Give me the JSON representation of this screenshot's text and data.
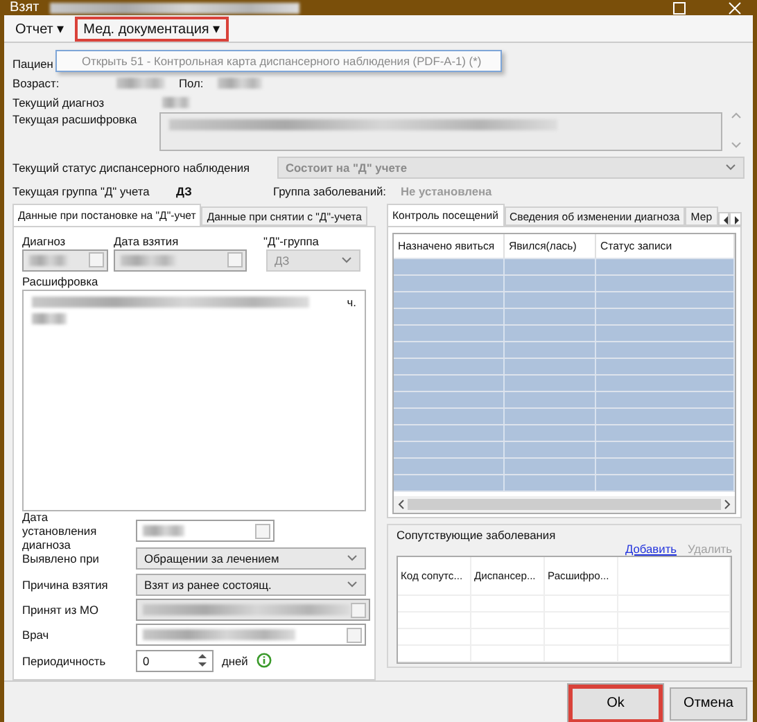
{
  "window": {
    "title": "Взят"
  },
  "menu": [
    {
      "label": "Отчет",
      "caret": "▾",
      "highlighted": false
    },
    {
      "label": "Мед. документация",
      "caret": "▾",
      "highlighted": true
    }
  ],
  "dropdown": {
    "items": [
      {
        "label": "Открыть 51 - Контрольная карта диспансерного наблюдения (PDF-A-1) (*)",
        "disabled": true
      }
    ]
  },
  "header": {
    "patient_label": "Пациен",
    "age_label": "Возраст:",
    "sex_label": "Пол:",
    "diagnosis_label": "Текущий диагноз",
    "decoding_label": "Текущая расшифровка",
    "status_label": "Текущий статус диспансерного наблюдения",
    "status_value": "Состоит на \"Д\" учете",
    "group_label": "Текущая группа \"Д\" учета",
    "group_value": "ДЗ",
    "disease_group_label": "Группа заболеваний:",
    "disease_group_value": "Не установлена"
  },
  "left_tabs": [
    {
      "label": "Данные при постановке на \"Д\"-учет",
      "selected": true
    },
    {
      "label": "Данные при снятии с \"Д\"-учета",
      "selected": false
    }
  ],
  "left_form": {
    "diagnosis_label": "Диагноз",
    "date_label": "Дата взятия",
    "group_label": "\"Д\"-группа",
    "group_value": "ДЗ",
    "decoding_label": "Расшифровка",
    "decoding_tail": "ч.",
    "diag_date_label": "Дата установления диагноза",
    "detected_label": "Выявлено при",
    "detected_value": "Обращении за лечением",
    "reason_label": "Причина взятия",
    "reason_value": "Взят из ранее состоящ.",
    "from_label": "Принят из МО",
    "doctor_label": "Врач",
    "period_label": "Периодичность",
    "period_value": "0",
    "period_unit": "дней"
  },
  "right_tabs": [
    {
      "label": "Контроль посещений",
      "selected": true
    },
    {
      "label": "Сведения об изменении диагноза",
      "selected": false
    },
    {
      "label": "Мер",
      "selected": false
    }
  ],
  "visits_table": {
    "columns": [
      "Назначено явиться",
      "Явился(лась)",
      "Статус записи"
    ]
  },
  "comorbid": {
    "title": "Сопутствующие заболевания",
    "add": "Добавить",
    "remove": "Удалить",
    "remove_disabled": true,
    "columns": [
      "Код сопутс...",
      "Диспансер...",
      "Расшифро..."
    ]
  },
  "buttons": [
    {
      "label": "Ok",
      "highlighted": true
    },
    {
      "label": "Отмена",
      "highlighted": false
    }
  ]
}
